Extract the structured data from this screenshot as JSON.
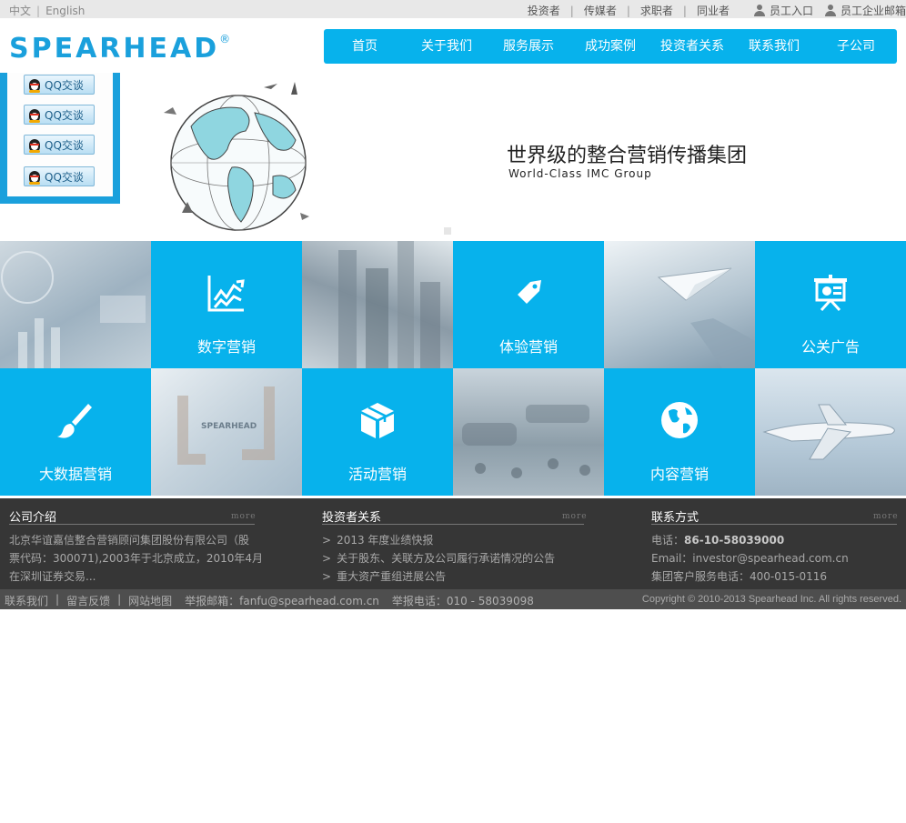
{
  "topbar": {
    "languages": [
      "中文",
      "English"
    ],
    "links": [
      "投资者",
      "传媒者",
      "求职者",
      "同业者"
    ],
    "employee_login": "员工入口",
    "employee_mail": "员工企业邮箱"
  },
  "header": {
    "logo_text": "SPEARHEAD",
    "logo_mark": "®",
    "nav": [
      "首页",
      "关于我们",
      "服务展示",
      "成功案例",
      "投资者关系",
      "联系我们",
      "子公司"
    ]
  },
  "qq": {
    "button_label": "QQ交谈"
  },
  "banner": {
    "slogan_cn": "世界级的整合营销传播集团",
    "slogan_en": "World-Class IMC Group"
  },
  "services": [
    {
      "label": "数字营销",
      "icon": "chart-trend-icon"
    },
    {
      "label": "体验营销",
      "icon": "tag-icon"
    },
    {
      "label": "公关广告",
      "icon": "presentation-icon"
    },
    {
      "label": "大数据营销",
      "icon": "brush-icon"
    },
    {
      "label": "活动营销",
      "icon": "box-icon"
    },
    {
      "label": "内容营销",
      "icon": "globe-icon"
    }
  ],
  "photo_tiles": [
    "business-chart-photo",
    "city-aerial-photo",
    "paper-plane-photo",
    "hands-frame-photo",
    "crowd-event-photo",
    "airplane-photo"
  ],
  "photo_text": {
    "hands_frame": "SPEARHEAD"
  },
  "footer": {
    "more": "more",
    "about": {
      "title": "公司介绍",
      "text": [
        "北京华谊嘉信整合营销顾问集团股份有限公司（股",
        "票代码：300071),2003年于北京成立，2010年4月",
        "在深圳证券交易..."
      ]
    },
    "investor": {
      "title": "投资者关系",
      "items": [
        "2013 年度业绩快报",
        "关于股东、关联方及公司履行承诺情况的公告",
        "重大资产重组进展公告"
      ]
    },
    "contact": {
      "title": "联系方式",
      "phone_label": "电话：",
      "phone": "86-10-58039000",
      "email_label": "Email：",
      "email": "investor@spearhead.com.cn",
      "service": "集团客户服务电话：400-015-0116"
    }
  },
  "bottombar": {
    "links": [
      "联系我们",
      "留言反馈",
      "网站地图"
    ],
    "report_email": "举报邮箱：fanfu@spearhead.com.cn",
    "report_phone": "举报电话：010 - 58039098",
    "copyright": "Copyright © 2010-2013 Spearhead Inc. All rights reserved."
  },
  "colors": {
    "brand_blue": "#07b2ec",
    "logo_blue": "#1aa0dc",
    "footer_bg": "#363636",
    "bottom_bg": "#4e4e4e"
  }
}
